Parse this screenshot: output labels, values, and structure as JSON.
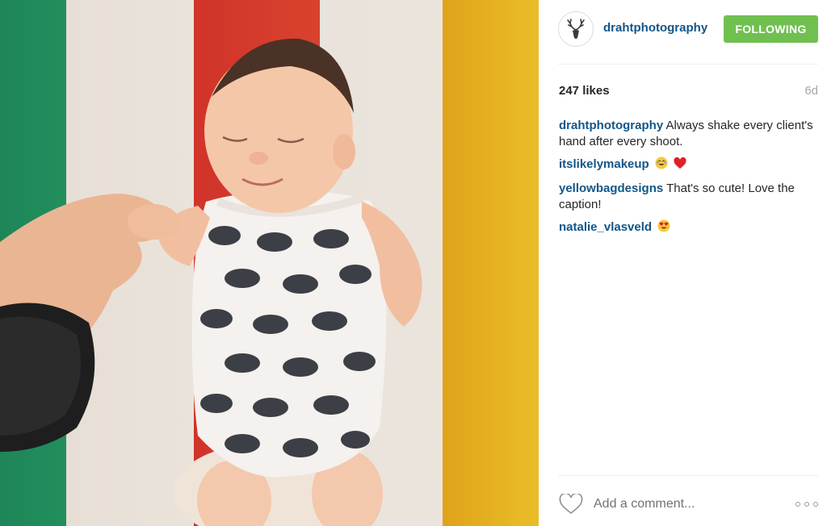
{
  "post": {
    "username": "drahtphotography",
    "follow_label": "FOLLOWING",
    "likes": "247 likes",
    "time_ago": "6d"
  },
  "comments": [
    {
      "author": "drahtphotography",
      "text": "Always shake every client's hand after every shoot.",
      "emoji": []
    },
    {
      "author": "itslikelymakeup",
      "text": "",
      "emoji": [
        "crying-laughing-face",
        "red-heart"
      ]
    },
    {
      "author": "yellowbagdesigns",
      "text": "That's so cute! Love the caption!",
      "emoji": []
    },
    {
      "author": "natalie_vlasveld",
      "text": "",
      "emoji": [
        "heart-eyes-face"
      ]
    }
  ],
  "composer": {
    "placeholder": "Add a comment..."
  },
  "icons": {
    "avatar": "deer-antlers-logo",
    "like": "heart-outline-icon",
    "more": "more-options-icon"
  },
  "colors": {
    "link_blue": "#125688",
    "follow_green": "#70c050",
    "time_gray": "#a5a7aa"
  }
}
